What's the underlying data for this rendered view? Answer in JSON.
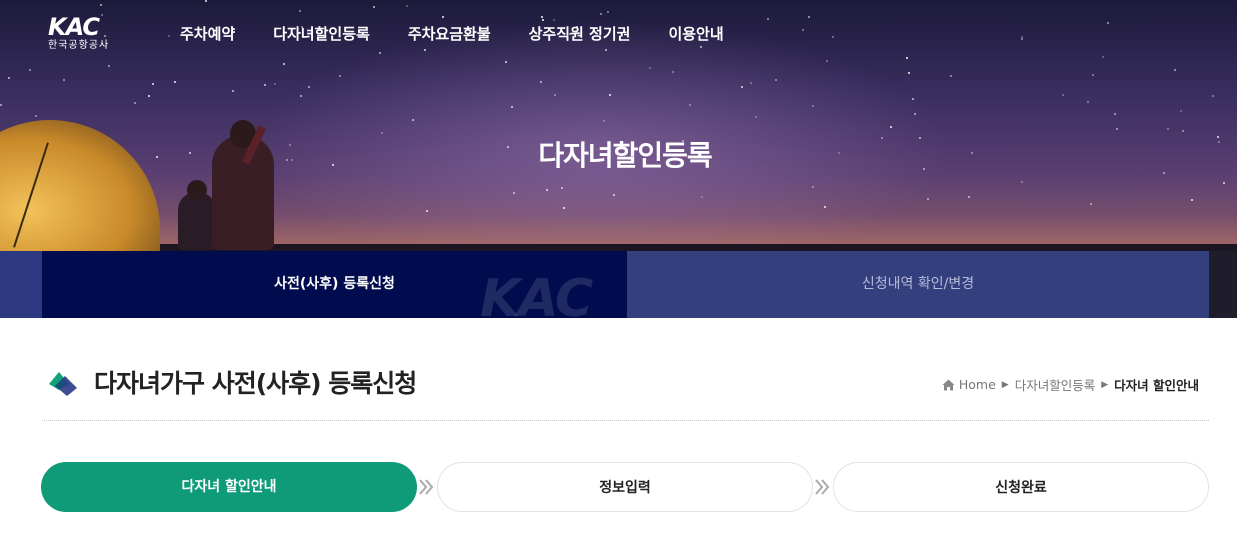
{
  "header": {
    "logo_mark": "KAC",
    "logo_sub": "한국공항공사",
    "nav": [
      "주차예약",
      "다자녀할인등록",
      "주차요금환불",
      "상주직원 정기권",
      "이용안내"
    ]
  },
  "hero": {
    "title": "다자녀할인등록"
  },
  "tabs": {
    "active": "사전(사후) 등록신청",
    "inactive": "신청내역 확인/변경",
    "watermark": "KAC"
  },
  "page": {
    "title": "다자녀가구 사전(사후) 등록신청"
  },
  "breadcrumb": {
    "home": "Home",
    "items": [
      "다자녀할인등록",
      "다자녀 할인안내"
    ]
  },
  "steps": [
    "다자녀 할인안내",
    "정보입력",
    "신청완료"
  ],
  "colors": {
    "accent_green": "#0f9a78",
    "tab_active": "#000c4e",
    "tab_inactive": "#34407e"
  }
}
